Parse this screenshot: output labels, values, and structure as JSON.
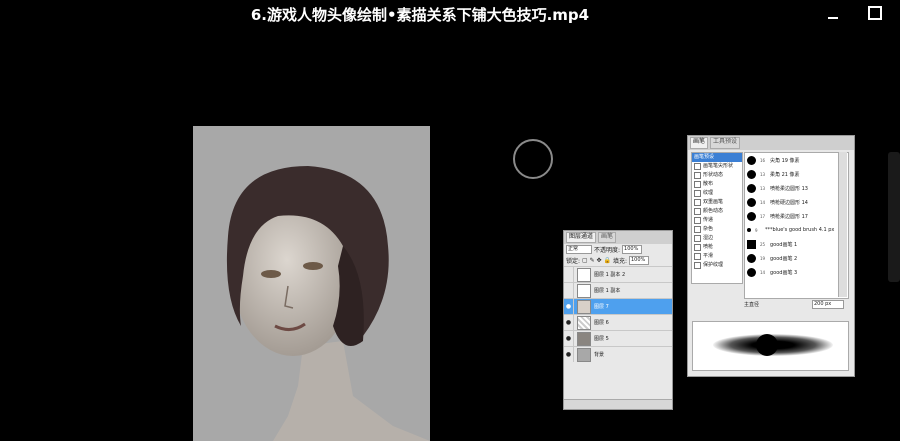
{
  "video": {
    "title": "6.游戏人物头像绘制•素描关系下铺大色技巧.mp4"
  },
  "layers_panel": {
    "tabs": [
      "图层通道",
      "画笔"
    ],
    "blend_mode": "正常",
    "opacity_label": "不透明度:",
    "opacity_value": "100%",
    "lock_label": "锁定:",
    "fill_label": "填充:",
    "fill_value": "100%",
    "layers": [
      {
        "name": "图层 1 副本 2",
        "visible": false,
        "selected": false
      },
      {
        "name": "图层 1 副本",
        "visible": false,
        "selected": false
      },
      {
        "name": "图层 7",
        "visible": true,
        "selected": true
      },
      {
        "name": "图层 6",
        "visible": true,
        "selected": false
      },
      {
        "name": "图层 5",
        "visible": true,
        "selected": false
      },
      {
        "name": "背景",
        "visible": true,
        "selected": false
      }
    ]
  },
  "brush_panel": {
    "tabs": [
      "画笔",
      "工具预设"
    ],
    "presets": [
      {
        "label": "画笔预设",
        "selected": true
      },
      {
        "label": "画笔笔尖形状",
        "selected": false
      },
      {
        "label": "形状动态",
        "selected": false
      },
      {
        "label": "散布",
        "selected": false
      },
      {
        "label": "纹理",
        "selected": false
      },
      {
        "label": "双重画笔",
        "selected": false
      },
      {
        "label": "颜色动态",
        "selected": false
      },
      {
        "label": "传递",
        "selected": false
      },
      {
        "label": "杂色",
        "selected": false
      },
      {
        "label": "湿边",
        "selected": false
      },
      {
        "label": "喷枪",
        "selected": false
      },
      {
        "label": "平滑",
        "selected": false
      },
      {
        "label": "保护纹理",
        "selected": false
      }
    ],
    "brushes": [
      {
        "size": "16",
        "name": "尖角 19 像素"
      },
      {
        "size": "13",
        "name": "柔角 21 像素"
      },
      {
        "size": "13",
        "name": "喷枪柔边圆形 13"
      },
      {
        "size": "14",
        "name": "喷枪硬边圆形 14"
      },
      {
        "size": "17",
        "name": "喷枪柔边圆形 17"
      },
      {
        "size": "9",
        "name": "***blue's good brush 4.1 px"
      },
      {
        "size": "25",
        "name": "good画笔 1"
      },
      {
        "size": "19",
        "name": "good画笔 2"
      },
      {
        "size": "14",
        "name": "good画笔 3"
      }
    ],
    "size_label": "主直径",
    "size_value": "200 px"
  }
}
